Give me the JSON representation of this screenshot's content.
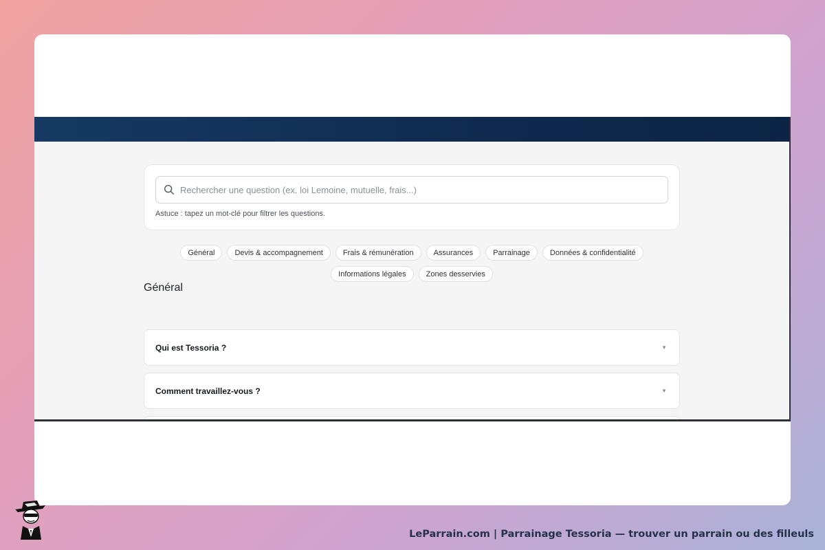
{
  "search": {
    "placeholder": "Rechercher une question (ex. loi Lemoine, mutuelle, frais...)",
    "hint": "Astuce : tapez un mot-clé pour filtrer les questions."
  },
  "categories": [
    "Général",
    "Devis & accompagnement",
    "Frais & rémunération",
    "Assurances",
    "Parrainage",
    "Données & confidentialité",
    "Informations légales",
    "Zones desservies"
  ],
  "section": {
    "title": "Général"
  },
  "faq": [
    {
      "question": "Qui est Tessoria ?"
    },
    {
      "question": "Comment travaillez-vous ?"
    }
  ],
  "footer": {
    "caption": "LeParrain.com | Parrainage Tessoria — trouver un parrain ou des filleuls"
  },
  "colors": {
    "navbar": "#0f2a4d",
    "background_card": "#ffffff",
    "page_bg": "#f5f5f6",
    "footer_text": "#25314a"
  },
  "icons": {
    "search": "search-icon",
    "chevron": "chevron-down-icon",
    "mascot": "mascot-logo"
  }
}
